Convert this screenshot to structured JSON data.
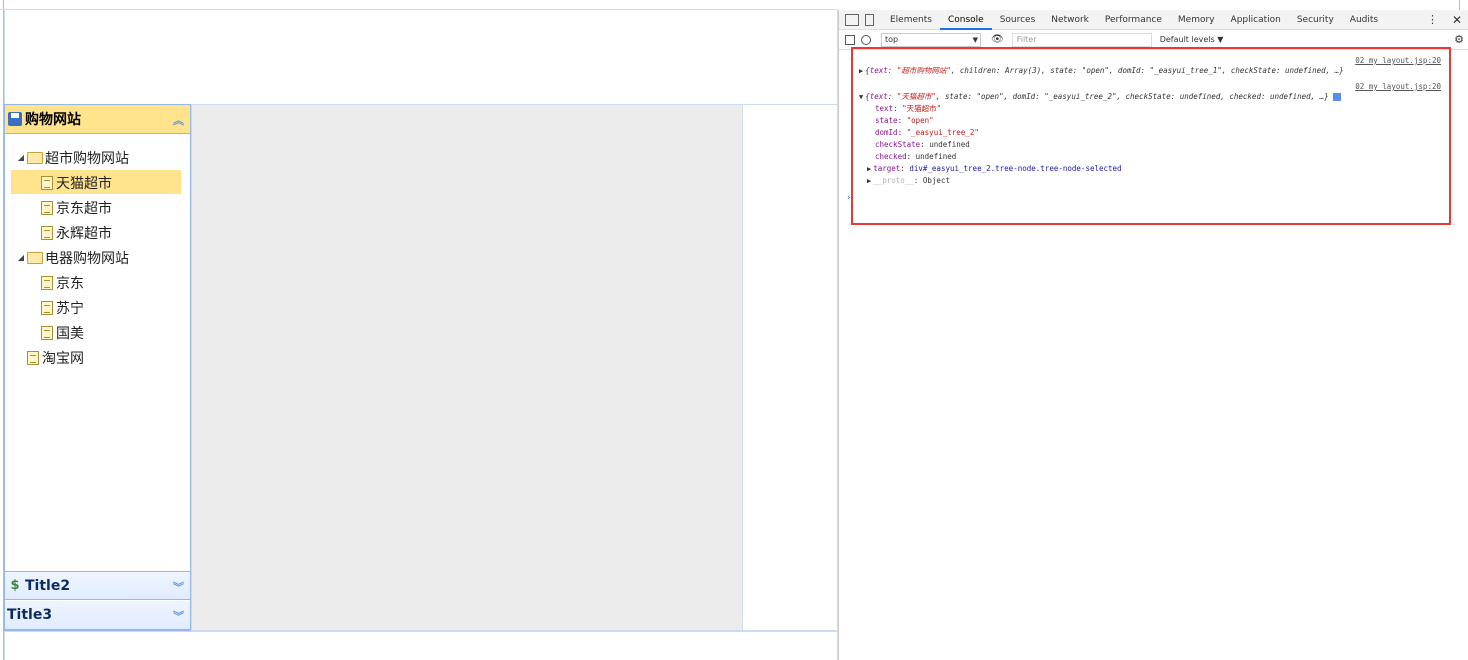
{
  "layout": {
    "west_accordion": {
      "panels": [
        {
          "title": "购物网站",
          "state": "expanded"
        },
        {
          "title": "Title2",
          "state": "collapsed"
        },
        {
          "title": "Title3",
          "state": "collapsed"
        }
      ]
    },
    "tree": {
      "nodes": [
        {
          "label": "超市购物网站",
          "type": "folder",
          "level": 0,
          "expanded": true
        },
        {
          "label": "天猫超市",
          "type": "file",
          "level": 1,
          "selected": true
        },
        {
          "label": "京东超市",
          "type": "file",
          "level": 1
        },
        {
          "label": "永辉超市",
          "type": "file",
          "level": 1
        },
        {
          "label": "电器购物网站",
          "type": "folder",
          "level": 0,
          "expanded": true
        },
        {
          "label": "京东",
          "type": "file",
          "level": 1
        },
        {
          "label": "苏宁",
          "type": "file",
          "level": 1
        },
        {
          "label": "国美",
          "type": "file",
          "level": 1
        },
        {
          "label": "淘宝网",
          "type": "file",
          "level": 0
        }
      ]
    }
  },
  "devtools": {
    "tabs": [
      "Elements",
      "Console",
      "Sources",
      "Network",
      "Performance",
      "Memory",
      "Application",
      "Security",
      "Audits"
    ],
    "active_tab": "Console",
    "context": "top",
    "filter_placeholder": "Filter",
    "levels": "Default levels ▼",
    "console": {
      "entry1": {
        "source": "02_my_layout.jsp:20",
        "text_key1": "text: ",
        "text_val1": "\"超市购物网站\"",
        "rest1": ", children: Array(3), state: \"open\", domId: \"_easyui_tree_1\", checkState: undefined, …}"
      },
      "entry2": {
        "source": "02_my_layout.jsp:20",
        "text_key": "text: ",
        "text_val": "\"天猫超市\"",
        "rest": ", state: \"open\", domId: \"_easyui_tree_2\", checkState: undefined, checked: undefined, …}",
        "props": [
          {
            "key": "text",
            "value": "\"天猫超市\""
          },
          {
            "key": "state",
            "value": "\"open\""
          },
          {
            "key": "domId",
            "value": "\"_easyui_tree_2\""
          },
          {
            "key": "checkState",
            "value": "undefined"
          },
          {
            "key": "checked",
            "value": "undefined"
          },
          {
            "key": "target",
            "value": "div#_easyui_tree_2.tree-node.tree-node-selected"
          },
          {
            "key": "__proto__",
            "value": "Object"
          }
        ]
      }
    }
  },
  "colors": {
    "selected_bg": "#ffe48d",
    "accordion_border": "#95b8e7",
    "console_highlight": "#e53935"
  }
}
